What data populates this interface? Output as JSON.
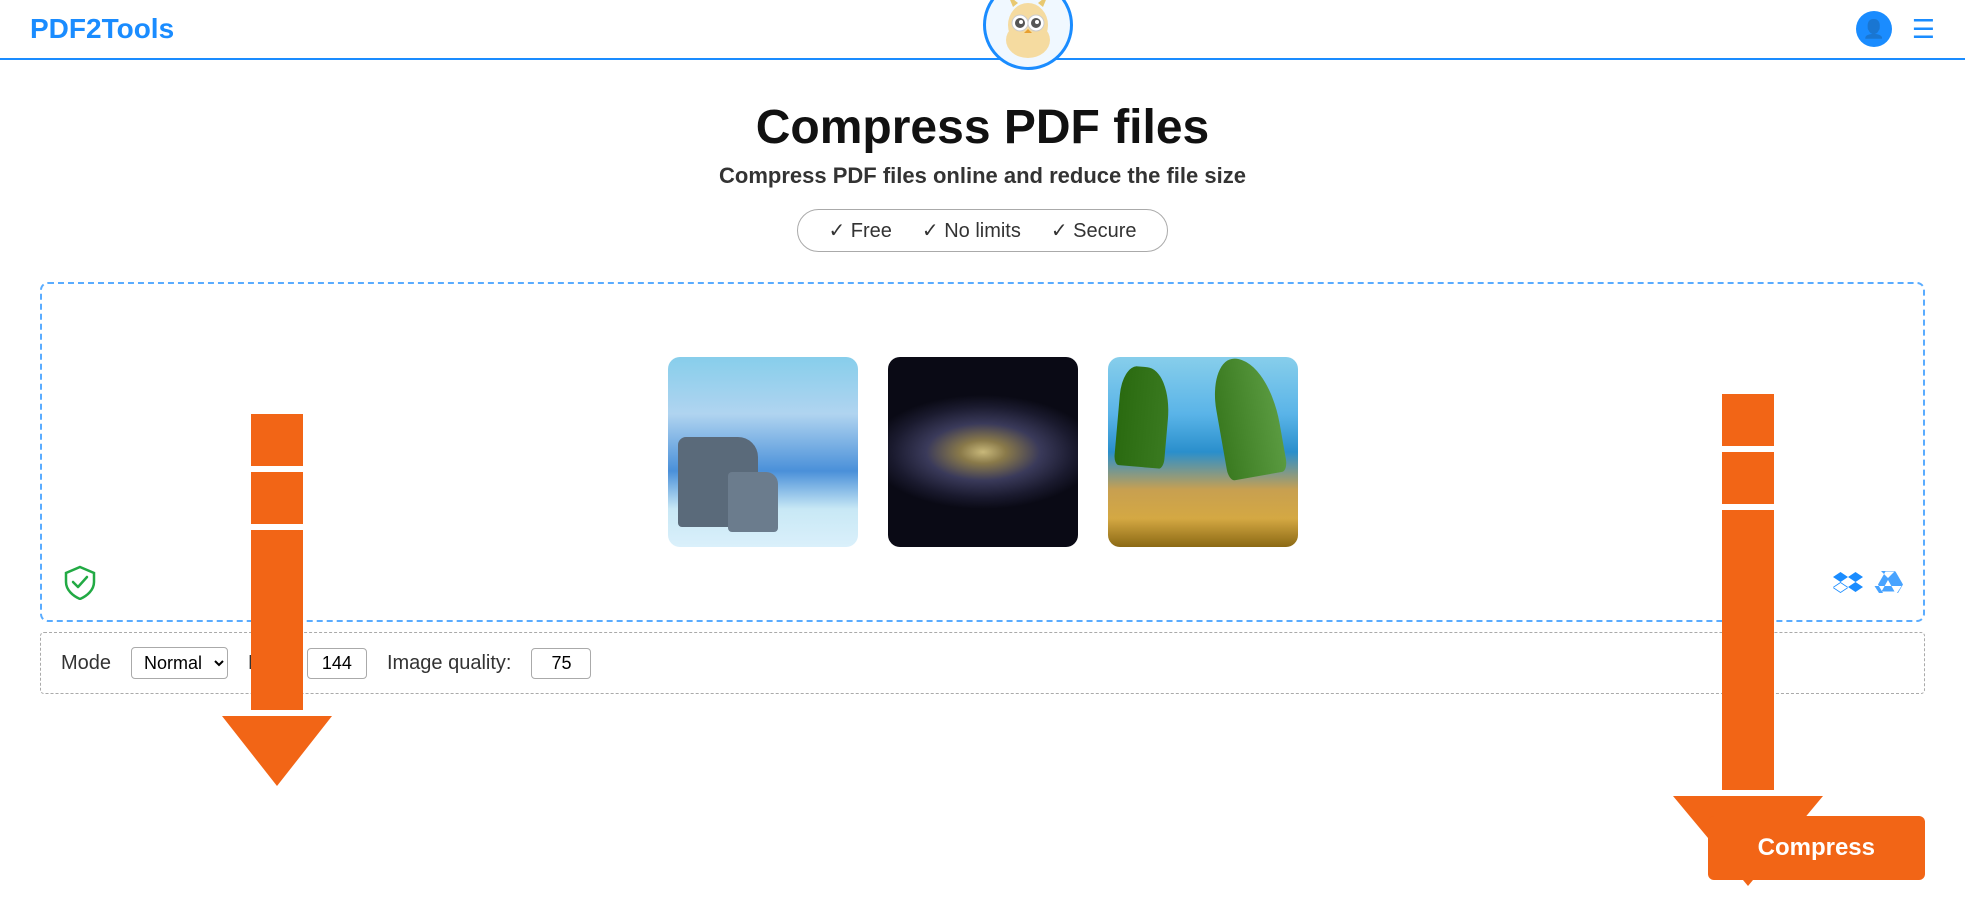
{
  "header": {
    "logo": "PDF2Tools",
    "user_icon": "👤",
    "menu_icon": "☰"
  },
  "hero": {
    "main_title": "Compress PDF files",
    "sub_title": "Compress PDF files online and reduce the file size",
    "badge": {
      "items": [
        {
          "label": "✓ Free"
        },
        {
          "label": "✓ No limits"
        },
        {
          "label": "✓ Secure"
        }
      ]
    }
  },
  "dropzone": {
    "images": [
      {
        "alt": "ocean scene"
      },
      {
        "alt": "galaxy"
      },
      {
        "alt": "tropical beach"
      }
    ],
    "security_label": "secure"
  },
  "toolbar": {
    "mode_label": "Mode",
    "mode_value": "Normal",
    "dpi_label": "DPI:",
    "dpi_value": "144",
    "quality_label": "Image quality:",
    "quality_value": "75"
  },
  "actions": {
    "compress_label": "Compress",
    "dropbox_icon": "dropbox",
    "drive_icon": "google-drive"
  }
}
